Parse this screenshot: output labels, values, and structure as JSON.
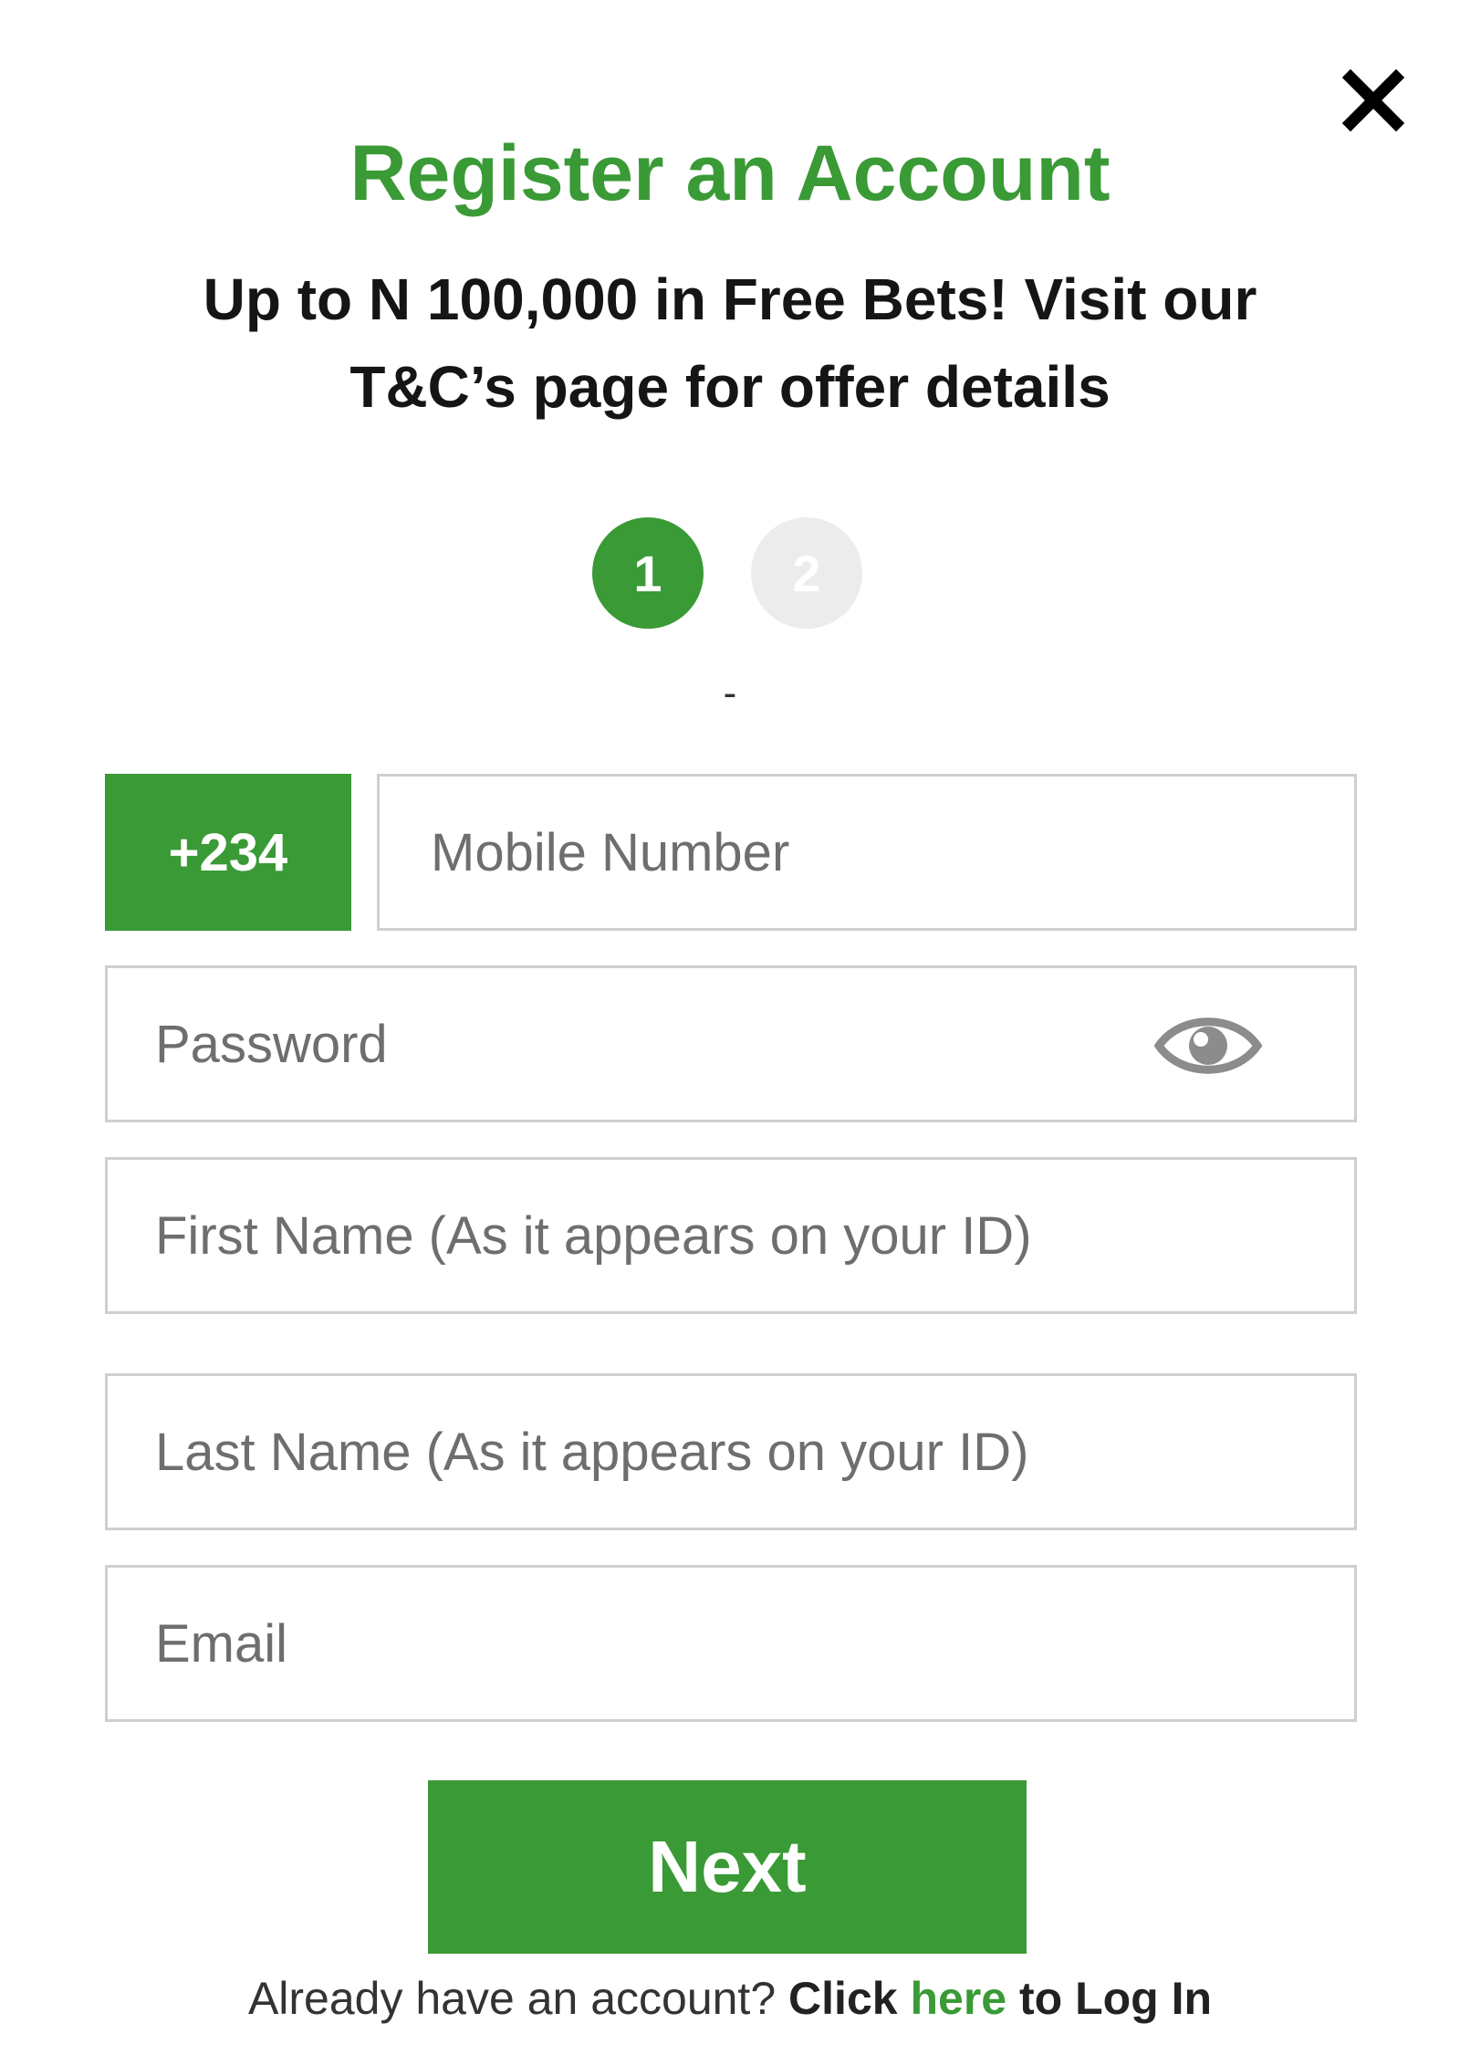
{
  "dialog": {
    "close_icon": "close-icon",
    "title": "Register an Account",
    "subtitle": "Up to N 100,000 in Free Bets! Visit our T&C’s page for offer details"
  },
  "steps": {
    "items": [
      {
        "label": "1",
        "state": "active",
        "color": "#3a9a36"
      },
      {
        "label": "2",
        "state": "inactive",
        "color": "#ececec"
      }
    ],
    "separator": "-"
  },
  "form": {
    "country_code": "+234",
    "mobile": {
      "placeholder": "Mobile Number",
      "value": ""
    },
    "password": {
      "placeholder": "Password",
      "value": "",
      "toggle_icon": "eye-icon"
    },
    "first_name": {
      "placeholder": "First Name (As it appears on your ID)",
      "value": ""
    },
    "last_name": {
      "placeholder": "Last Name (As it appears on your ID)",
      "value": ""
    },
    "email": {
      "placeholder": "Email",
      "value": ""
    },
    "next_label": "Next"
  },
  "login_prompt": {
    "prefix": "Already have an account?",
    "click": "Click",
    "link": "here",
    "suffix": "to Log In"
  },
  "colors": {
    "brand_green": "#3a9a36",
    "field_border": "#cfcfcf",
    "step_inactive": "#ececec"
  }
}
